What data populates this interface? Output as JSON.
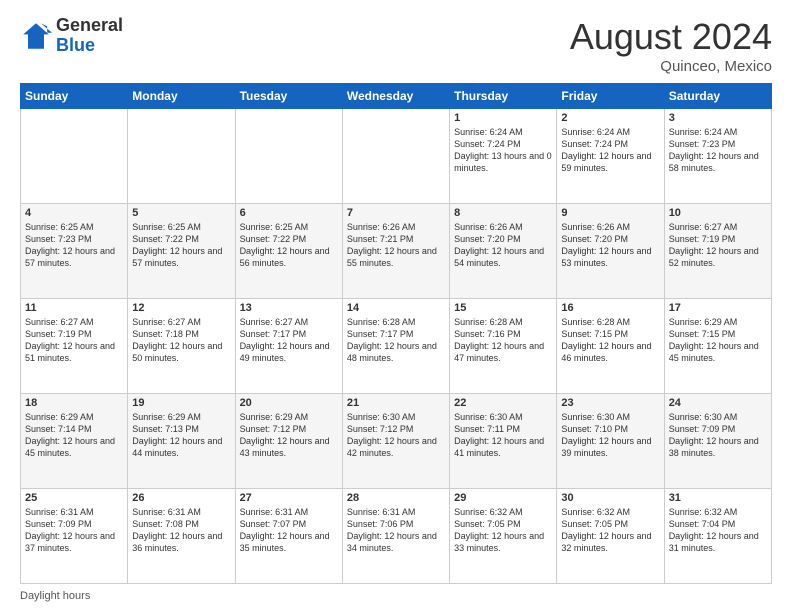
{
  "header": {
    "logo_general": "General",
    "logo_blue": "Blue",
    "month_year": "August 2024",
    "location": "Quinceo, Mexico"
  },
  "footer": {
    "label": "Daylight hours"
  },
  "weekdays": [
    "Sunday",
    "Monday",
    "Tuesday",
    "Wednesday",
    "Thursday",
    "Friday",
    "Saturday"
  ],
  "weeks": [
    [
      {
        "day": "",
        "sunrise": "",
        "sunset": "",
        "daylight": ""
      },
      {
        "day": "",
        "sunrise": "",
        "sunset": "",
        "daylight": ""
      },
      {
        "day": "",
        "sunrise": "",
        "sunset": "",
        "daylight": ""
      },
      {
        "day": "",
        "sunrise": "",
        "sunset": "",
        "daylight": ""
      },
      {
        "day": "1",
        "sunrise": "Sunrise: 6:24 AM",
        "sunset": "Sunset: 7:24 PM",
        "daylight": "Daylight: 13 hours and 0 minutes."
      },
      {
        "day": "2",
        "sunrise": "Sunrise: 6:24 AM",
        "sunset": "Sunset: 7:24 PM",
        "daylight": "Daylight: 12 hours and 59 minutes."
      },
      {
        "day": "3",
        "sunrise": "Sunrise: 6:24 AM",
        "sunset": "Sunset: 7:23 PM",
        "daylight": "Daylight: 12 hours and 58 minutes."
      }
    ],
    [
      {
        "day": "4",
        "sunrise": "Sunrise: 6:25 AM",
        "sunset": "Sunset: 7:23 PM",
        "daylight": "Daylight: 12 hours and 57 minutes."
      },
      {
        "day": "5",
        "sunrise": "Sunrise: 6:25 AM",
        "sunset": "Sunset: 7:22 PM",
        "daylight": "Daylight: 12 hours and 57 minutes."
      },
      {
        "day": "6",
        "sunrise": "Sunrise: 6:25 AM",
        "sunset": "Sunset: 7:22 PM",
        "daylight": "Daylight: 12 hours and 56 minutes."
      },
      {
        "day": "7",
        "sunrise": "Sunrise: 6:26 AM",
        "sunset": "Sunset: 7:21 PM",
        "daylight": "Daylight: 12 hours and 55 minutes."
      },
      {
        "day": "8",
        "sunrise": "Sunrise: 6:26 AM",
        "sunset": "Sunset: 7:20 PM",
        "daylight": "Daylight: 12 hours and 54 minutes."
      },
      {
        "day": "9",
        "sunrise": "Sunrise: 6:26 AM",
        "sunset": "Sunset: 7:20 PM",
        "daylight": "Daylight: 12 hours and 53 minutes."
      },
      {
        "day": "10",
        "sunrise": "Sunrise: 6:27 AM",
        "sunset": "Sunset: 7:19 PM",
        "daylight": "Daylight: 12 hours and 52 minutes."
      }
    ],
    [
      {
        "day": "11",
        "sunrise": "Sunrise: 6:27 AM",
        "sunset": "Sunset: 7:19 PM",
        "daylight": "Daylight: 12 hours and 51 minutes."
      },
      {
        "day": "12",
        "sunrise": "Sunrise: 6:27 AM",
        "sunset": "Sunset: 7:18 PM",
        "daylight": "Daylight: 12 hours and 50 minutes."
      },
      {
        "day": "13",
        "sunrise": "Sunrise: 6:27 AM",
        "sunset": "Sunset: 7:17 PM",
        "daylight": "Daylight: 12 hours and 49 minutes."
      },
      {
        "day": "14",
        "sunrise": "Sunrise: 6:28 AM",
        "sunset": "Sunset: 7:17 PM",
        "daylight": "Daylight: 12 hours and 48 minutes."
      },
      {
        "day": "15",
        "sunrise": "Sunrise: 6:28 AM",
        "sunset": "Sunset: 7:16 PM",
        "daylight": "Daylight: 12 hours and 47 minutes."
      },
      {
        "day": "16",
        "sunrise": "Sunrise: 6:28 AM",
        "sunset": "Sunset: 7:15 PM",
        "daylight": "Daylight: 12 hours and 46 minutes."
      },
      {
        "day": "17",
        "sunrise": "Sunrise: 6:29 AM",
        "sunset": "Sunset: 7:15 PM",
        "daylight": "Daylight: 12 hours and 45 minutes."
      }
    ],
    [
      {
        "day": "18",
        "sunrise": "Sunrise: 6:29 AM",
        "sunset": "Sunset: 7:14 PM",
        "daylight": "Daylight: 12 hours and 45 minutes."
      },
      {
        "day": "19",
        "sunrise": "Sunrise: 6:29 AM",
        "sunset": "Sunset: 7:13 PM",
        "daylight": "Daylight: 12 hours and 44 minutes."
      },
      {
        "day": "20",
        "sunrise": "Sunrise: 6:29 AM",
        "sunset": "Sunset: 7:12 PM",
        "daylight": "Daylight: 12 hours and 43 minutes."
      },
      {
        "day": "21",
        "sunrise": "Sunrise: 6:30 AM",
        "sunset": "Sunset: 7:12 PM",
        "daylight": "Daylight: 12 hours and 42 minutes."
      },
      {
        "day": "22",
        "sunrise": "Sunrise: 6:30 AM",
        "sunset": "Sunset: 7:11 PM",
        "daylight": "Daylight: 12 hours and 41 minutes."
      },
      {
        "day": "23",
        "sunrise": "Sunrise: 6:30 AM",
        "sunset": "Sunset: 7:10 PM",
        "daylight": "Daylight: 12 hours and 39 minutes."
      },
      {
        "day": "24",
        "sunrise": "Sunrise: 6:30 AM",
        "sunset": "Sunset: 7:09 PM",
        "daylight": "Daylight: 12 hours and 38 minutes."
      }
    ],
    [
      {
        "day": "25",
        "sunrise": "Sunrise: 6:31 AM",
        "sunset": "Sunset: 7:09 PM",
        "daylight": "Daylight: 12 hours and 37 minutes."
      },
      {
        "day": "26",
        "sunrise": "Sunrise: 6:31 AM",
        "sunset": "Sunset: 7:08 PM",
        "daylight": "Daylight: 12 hours and 36 minutes."
      },
      {
        "day": "27",
        "sunrise": "Sunrise: 6:31 AM",
        "sunset": "Sunset: 7:07 PM",
        "daylight": "Daylight: 12 hours and 35 minutes."
      },
      {
        "day": "28",
        "sunrise": "Sunrise: 6:31 AM",
        "sunset": "Sunset: 7:06 PM",
        "daylight": "Daylight: 12 hours and 34 minutes."
      },
      {
        "day": "29",
        "sunrise": "Sunrise: 6:32 AM",
        "sunset": "Sunset: 7:05 PM",
        "daylight": "Daylight: 12 hours and 33 minutes."
      },
      {
        "day": "30",
        "sunrise": "Sunrise: 6:32 AM",
        "sunset": "Sunset: 7:05 PM",
        "daylight": "Daylight: 12 hours and 32 minutes."
      },
      {
        "day": "31",
        "sunrise": "Sunrise: 6:32 AM",
        "sunset": "Sunset: 7:04 PM",
        "daylight": "Daylight: 12 hours and 31 minutes."
      }
    ]
  ]
}
